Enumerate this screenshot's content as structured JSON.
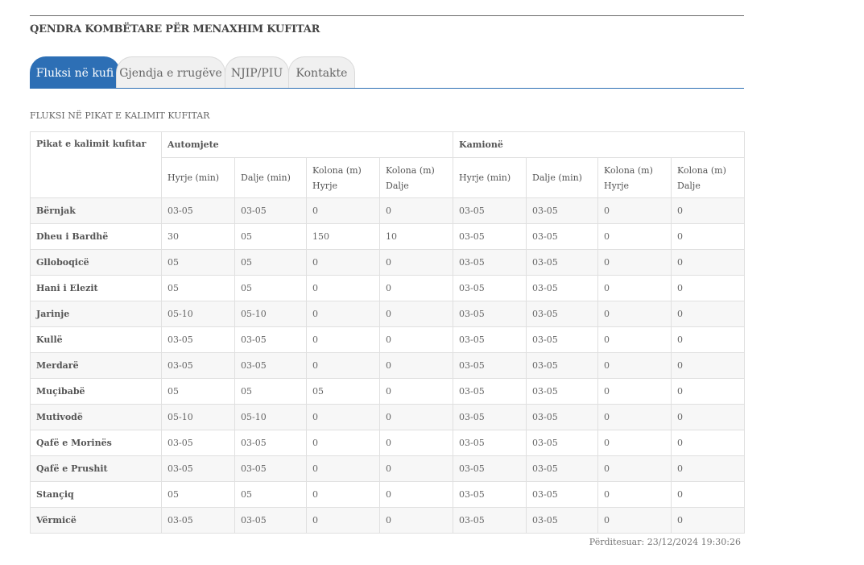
{
  "header": {
    "org_name": "QENDRA KOMBËTARE PËR MENAXHIM KUFITAR"
  },
  "tabs": [
    {
      "label": "Fluksi në kufi",
      "active": true
    },
    {
      "label": "Gjendja e rrugëve",
      "active": false
    },
    {
      "label": "NJIP/PIU",
      "active": false
    },
    {
      "label": "Kontakte",
      "active": false
    }
  ],
  "section": {
    "title": "FLUKSI NË PIKAT E KALIMIT KUFITAR"
  },
  "table": {
    "col_crossing": "Pikat e kalimit kufitar",
    "group_cars": "Automjete",
    "group_trucks": "Kamionë",
    "sub_headers": [
      "Hyrje (min)",
      "Dalje (min)",
      "Kolona (m) Hyrje",
      "Kolona (m) Dalje",
      "Hyrje (min)",
      "Dalje (min)",
      "Kolona (m) Hyrje",
      "Kolona (m) Dalje"
    ],
    "rows": [
      {
        "name": "Bërnjak",
        "values": [
          "03-05",
          "03-05",
          "0",
          "0",
          "03-05",
          "03-05",
          "0",
          "0"
        ]
      },
      {
        "name": "Dheu i Bardhë",
        "values": [
          "30",
          "05",
          "150",
          "10",
          "03-05",
          "03-05",
          "0",
          "0"
        ]
      },
      {
        "name": "Glloboqicë",
        "values": [
          "05",
          "05",
          "0",
          "0",
          "03-05",
          "03-05",
          "0",
          "0"
        ]
      },
      {
        "name": "Hani i Elezit",
        "values": [
          "05",
          "05",
          "0",
          "0",
          "03-05",
          "03-05",
          "0",
          "0"
        ]
      },
      {
        "name": "Jarinje",
        "values": [
          "05-10",
          "05-10",
          "0",
          "0",
          "03-05",
          "03-05",
          "0",
          "0"
        ]
      },
      {
        "name": "Kullë",
        "values": [
          "03-05",
          "03-05",
          "0",
          "0",
          "03-05",
          "03-05",
          "0",
          "0"
        ]
      },
      {
        "name": "Merdarë",
        "values": [
          "03-05",
          "03-05",
          "0",
          "0",
          "03-05",
          "03-05",
          "0",
          "0"
        ]
      },
      {
        "name": "Muçibabë",
        "values": [
          "05",
          "05",
          "05",
          "0",
          "03-05",
          "03-05",
          "0",
          "0"
        ]
      },
      {
        "name": "Mutivodë",
        "values": [
          "05-10",
          "05-10",
          "0",
          "0",
          "03-05",
          "03-05",
          "0",
          "0"
        ]
      },
      {
        "name": "Qafë e Morinës",
        "values": [
          "03-05",
          "03-05",
          "0",
          "0",
          "03-05",
          "03-05",
          "0",
          "0"
        ]
      },
      {
        "name": "Qafë e Prushit",
        "values": [
          "03-05",
          "03-05",
          "0",
          "0",
          "03-05",
          "03-05",
          "0",
          "0"
        ]
      },
      {
        "name": "Stançiq",
        "values": [
          "05",
          "05",
          "0",
          "0",
          "03-05",
          "03-05",
          "0",
          "0"
        ]
      },
      {
        "name": "Vërmicë",
        "values": [
          "03-05",
          "03-05",
          "0",
          "0",
          "03-05",
          "03-05",
          "0",
          "0"
        ]
      }
    ]
  },
  "footer": {
    "updated": "Përditesuar: 23/12/2024 19:30:26"
  },
  "colors": {
    "accent": "#2d6fb5",
    "row_alt": "#f7f7f7",
    "border": "#e0e0e0"
  }
}
